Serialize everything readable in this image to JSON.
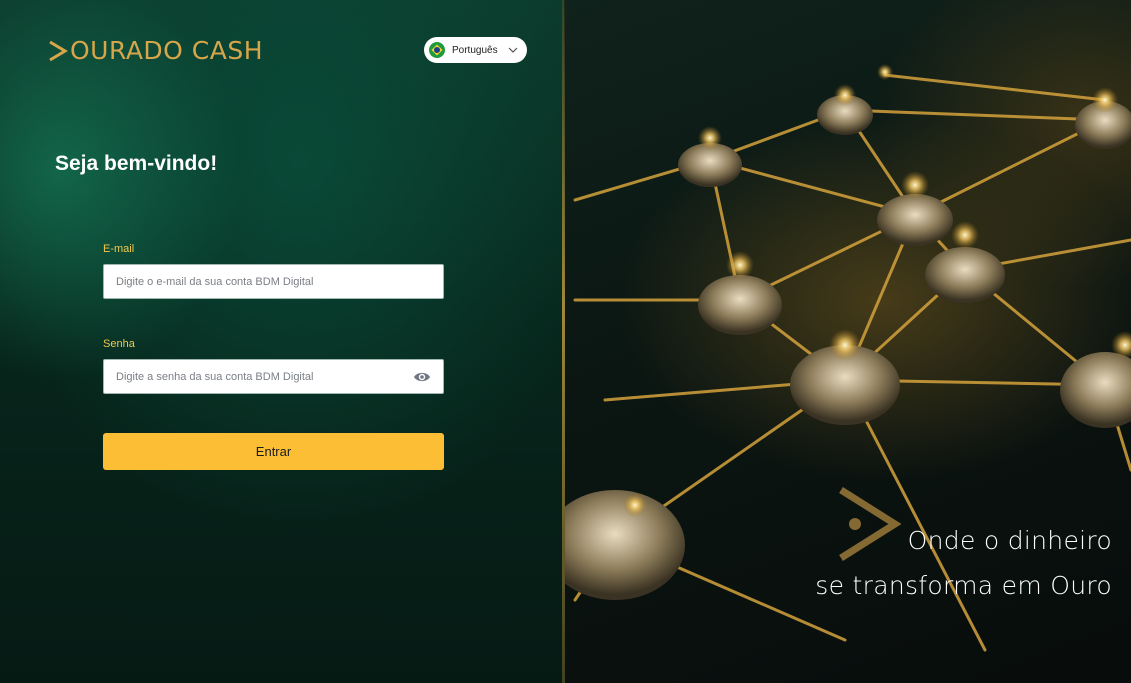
{
  "brand": {
    "logo_text": "OURADO CASH",
    "color": "#d7a54a"
  },
  "language": {
    "selected": "Português",
    "flag_icon": "brazil-flag-icon"
  },
  "login": {
    "title": "Seja bem-vindo!",
    "email_label": "E-mail",
    "email_placeholder": "Digite o e-mail da sua conta BDM Digital",
    "password_label": "Senha",
    "password_placeholder": "Digite a senha da sua conta BDM Digital",
    "submit_label": "Entrar"
  },
  "hero": {
    "line1": "Onde o dinheiro",
    "line2": "se transforma em Ouro"
  },
  "colors": {
    "accent": "#fbbe35",
    "label": "#f2c84b",
    "panel": "#07261c"
  }
}
